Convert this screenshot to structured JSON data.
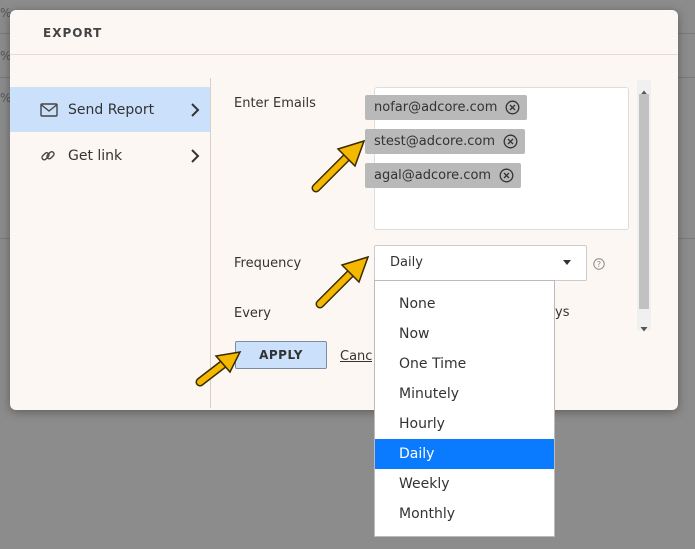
{
  "background": {
    "edge_marks": [
      "%",
      "%",
      "%"
    ]
  },
  "modal": {
    "title": "EXPORT"
  },
  "sidebar": {
    "items": [
      {
        "label": "Send Report",
        "icon": "envelope-icon",
        "active": true
      },
      {
        "label": "Get link",
        "icon": "link-icon",
        "active": false
      }
    ]
  },
  "form": {
    "emails_label": "Enter Emails",
    "emails": [
      "nofar@adcore.com",
      "stest@adcore.com",
      "agal@adcore.com"
    ],
    "frequency_label": "Frequency",
    "frequency_value": "Daily",
    "every_label": "Every",
    "every_suffix": "ys"
  },
  "buttons": {
    "apply": "APPLY",
    "cancel": "Cancel"
  },
  "dropdown": {
    "options": [
      "None",
      "Now",
      "One Time",
      "Minutely",
      "Hourly",
      "Daily",
      "Weekly",
      "Monthly"
    ],
    "selected": "Daily"
  },
  "colors": {
    "accent": "#0a7bff",
    "active_item": "#cbe1fb",
    "chip": "#b9b9b9",
    "annotation_arrow": "#f5b800"
  }
}
